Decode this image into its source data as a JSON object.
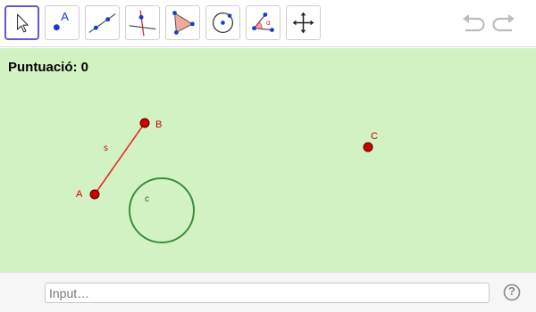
{
  "toolbar": {
    "tools": [
      {
        "name": "move-tool",
        "label_icon": "arrow-cursor-icon",
        "selected": true
      },
      {
        "name": "point-tool",
        "label_icon": "point-icon"
      },
      {
        "name": "line-tool",
        "label_icon": "line-through-points-icon"
      },
      {
        "name": "perpendicular-line-tool",
        "label_icon": "perpendicular-line-icon"
      },
      {
        "name": "polygon-tool",
        "label_icon": "polygon-icon"
      },
      {
        "name": "circle-tool",
        "label_icon": "circle-center-point-icon"
      },
      {
        "name": "angle-tool",
        "label_icon": "angle-icon"
      },
      {
        "name": "move-graphics-view-tool",
        "label_icon": "move-arrows-icon"
      }
    ],
    "point_tool_letter": "A",
    "angle_tool_letter": "α",
    "undo_icon": "undo-icon",
    "redo_icon": "redo-icon"
  },
  "graphics": {
    "score_label": "Puntuació: 0",
    "points": {
      "A": {
        "label": "A"
      },
      "B": {
        "label": "B"
      },
      "C": {
        "label": "C"
      }
    },
    "segment_label": "s",
    "circle_label": "c",
    "colors": {
      "background": "#d3f2c4",
      "point_fill": "#cc0000",
      "segment": "#e0302a",
      "circle": "#3c8c3c",
      "label_red": "#cc0000",
      "label_green": "#2e6b2e"
    }
  },
  "inputbar": {
    "placeholder": "Input…",
    "help_label": "?"
  }
}
